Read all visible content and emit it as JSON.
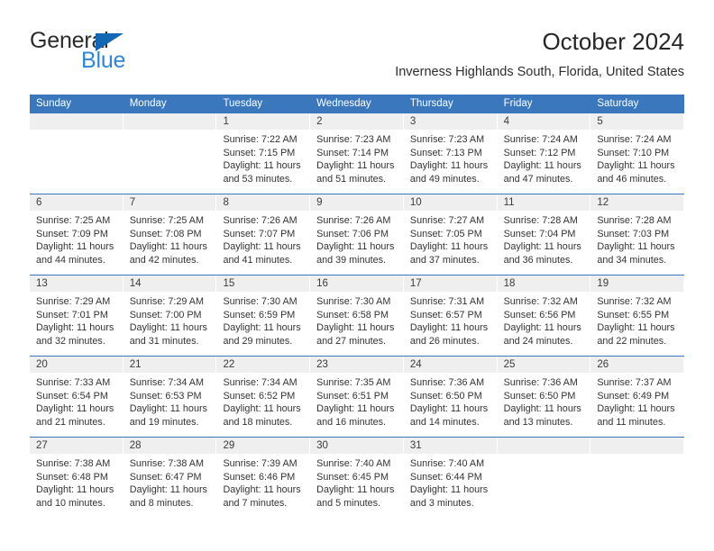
{
  "brand": {
    "line1": "General",
    "line2": "Blue",
    "triangle_color": "#1467b3",
    "line2_color": "#2f86d4"
  },
  "header": {
    "title": "October 2024",
    "subtitle": "Inverness Highlands South, Florida, United States"
  },
  "theme": {
    "header_blue": "#3a77bd",
    "day_band_gray": "#efefef",
    "text": "#333333"
  },
  "calendar": {
    "weekdays": [
      "Sunday",
      "Monday",
      "Tuesday",
      "Wednesday",
      "Thursday",
      "Friday",
      "Saturday"
    ],
    "weeks": [
      [
        {
          "day": "",
          "lines": []
        },
        {
          "day": "",
          "lines": []
        },
        {
          "day": "1",
          "lines": [
            "Sunrise: 7:22 AM",
            "Sunset: 7:15 PM",
            "Daylight: 11 hours",
            "and 53 minutes."
          ]
        },
        {
          "day": "2",
          "lines": [
            "Sunrise: 7:23 AM",
            "Sunset: 7:14 PM",
            "Daylight: 11 hours",
            "and 51 minutes."
          ]
        },
        {
          "day": "3",
          "lines": [
            "Sunrise: 7:23 AM",
            "Sunset: 7:13 PM",
            "Daylight: 11 hours",
            "and 49 minutes."
          ]
        },
        {
          "day": "4",
          "lines": [
            "Sunrise: 7:24 AM",
            "Sunset: 7:12 PM",
            "Daylight: 11 hours",
            "and 47 minutes."
          ]
        },
        {
          "day": "5",
          "lines": [
            "Sunrise: 7:24 AM",
            "Sunset: 7:10 PM",
            "Daylight: 11 hours",
            "and 46 minutes."
          ]
        }
      ],
      [
        {
          "day": "6",
          "lines": [
            "Sunrise: 7:25 AM",
            "Sunset: 7:09 PM",
            "Daylight: 11 hours",
            "and 44 minutes."
          ]
        },
        {
          "day": "7",
          "lines": [
            "Sunrise: 7:25 AM",
            "Sunset: 7:08 PM",
            "Daylight: 11 hours",
            "and 42 minutes."
          ]
        },
        {
          "day": "8",
          "lines": [
            "Sunrise: 7:26 AM",
            "Sunset: 7:07 PM",
            "Daylight: 11 hours",
            "and 41 minutes."
          ]
        },
        {
          "day": "9",
          "lines": [
            "Sunrise: 7:26 AM",
            "Sunset: 7:06 PM",
            "Daylight: 11 hours",
            "and 39 minutes."
          ]
        },
        {
          "day": "10",
          "lines": [
            "Sunrise: 7:27 AM",
            "Sunset: 7:05 PM",
            "Daylight: 11 hours",
            "and 37 minutes."
          ]
        },
        {
          "day": "11",
          "lines": [
            "Sunrise: 7:28 AM",
            "Sunset: 7:04 PM",
            "Daylight: 11 hours",
            "and 36 minutes."
          ]
        },
        {
          "day": "12",
          "lines": [
            "Sunrise: 7:28 AM",
            "Sunset: 7:03 PM",
            "Daylight: 11 hours",
            "and 34 minutes."
          ]
        }
      ],
      [
        {
          "day": "13",
          "lines": [
            "Sunrise: 7:29 AM",
            "Sunset: 7:01 PM",
            "Daylight: 11 hours",
            "and 32 minutes."
          ]
        },
        {
          "day": "14",
          "lines": [
            "Sunrise: 7:29 AM",
            "Sunset: 7:00 PM",
            "Daylight: 11 hours",
            "and 31 minutes."
          ]
        },
        {
          "day": "15",
          "lines": [
            "Sunrise: 7:30 AM",
            "Sunset: 6:59 PM",
            "Daylight: 11 hours",
            "and 29 minutes."
          ]
        },
        {
          "day": "16",
          "lines": [
            "Sunrise: 7:30 AM",
            "Sunset: 6:58 PM",
            "Daylight: 11 hours",
            "and 27 minutes."
          ]
        },
        {
          "day": "17",
          "lines": [
            "Sunrise: 7:31 AM",
            "Sunset: 6:57 PM",
            "Daylight: 11 hours",
            "and 26 minutes."
          ]
        },
        {
          "day": "18",
          "lines": [
            "Sunrise: 7:32 AM",
            "Sunset: 6:56 PM",
            "Daylight: 11 hours",
            "and 24 minutes."
          ]
        },
        {
          "day": "19",
          "lines": [
            "Sunrise: 7:32 AM",
            "Sunset: 6:55 PM",
            "Daylight: 11 hours",
            "and 22 minutes."
          ]
        }
      ],
      [
        {
          "day": "20",
          "lines": [
            "Sunrise: 7:33 AM",
            "Sunset: 6:54 PM",
            "Daylight: 11 hours",
            "and 21 minutes."
          ]
        },
        {
          "day": "21",
          "lines": [
            "Sunrise: 7:34 AM",
            "Sunset: 6:53 PM",
            "Daylight: 11 hours",
            "and 19 minutes."
          ]
        },
        {
          "day": "22",
          "lines": [
            "Sunrise: 7:34 AM",
            "Sunset: 6:52 PM",
            "Daylight: 11 hours",
            "and 18 minutes."
          ]
        },
        {
          "day": "23",
          "lines": [
            "Sunrise: 7:35 AM",
            "Sunset: 6:51 PM",
            "Daylight: 11 hours",
            "and 16 minutes."
          ]
        },
        {
          "day": "24",
          "lines": [
            "Sunrise: 7:36 AM",
            "Sunset: 6:50 PM",
            "Daylight: 11 hours",
            "and 14 minutes."
          ]
        },
        {
          "day": "25",
          "lines": [
            "Sunrise: 7:36 AM",
            "Sunset: 6:50 PM",
            "Daylight: 11 hours",
            "and 13 minutes."
          ]
        },
        {
          "day": "26",
          "lines": [
            "Sunrise: 7:37 AM",
            "Sunset: 6:49 PM",
            "Daylight: 11 hours",
            "and 11 minutes."
          ]
        }
      ],
      [
        {
          "day": "27",
          "lines": [
            "Sunrise: 7:38 AM",
            "Sunset: 6:48 PM",
            "Daylight: 11 hours",
            "and 10 minutes."
          ]
        },
        {
          "day": "28",
          "lines": [
            "Sunrise: 7:38 AM",
            "Sunset: 6:47 PM",
            "Daylight: 11 hours",
            "and 8 minutes."
          ]
        },
        {
          "day": "29",
          "lines": [
            "Sunrise: 7:39 AM",
            "Sunset: 6:46 PM",
            "Daylight: 11 hours",
            "and 7 minutes."
          ]
        },
        {
          "day": "30",
          "lines": [
            "Sunrise: 7:40 AM",
            "Sunset: 6:45 PM",
            "Daylight: 11 hours",
            "and 5 minutes."
          ]
        },
        {
          "day": "31",
          "lines": [
            "Sunrise: 7:40 AM",
            "Sunset: 6:44 PM",
            "Daylight: 11 hours",
            "and 3 minutes."
          ]
        },
        {
          "day": "",
          "lines": []
        },
        {
          "day": "",
          "lines": []
        }
      ]
    ]
  }
}
